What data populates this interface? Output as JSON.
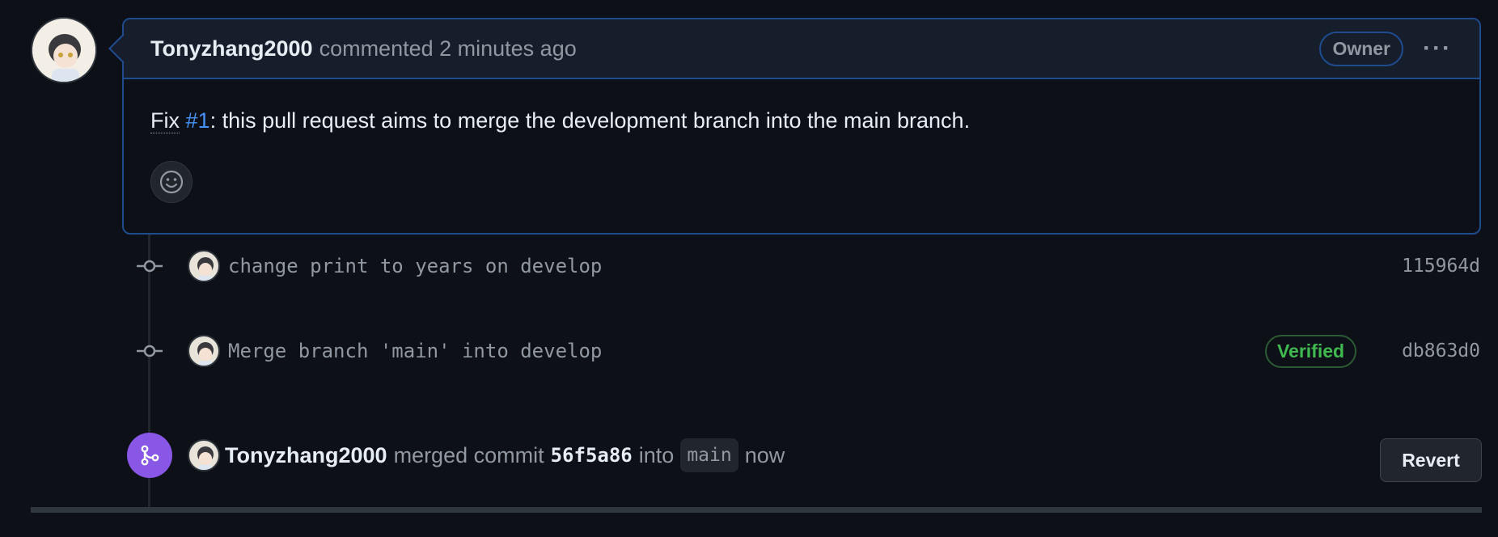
{
  "comment": {
    "author": "Tonyzhang2000",
    "meta": "commented 2 minutes ago",
    "badge": "Owner",
    "menu": "···",
    "body_fix": "Fix",
    "body_link": "#1",
    "body_rest": ": this pull request aims to merge the development branch into the main branch."
  },
  "commits": [
    {
      "message": "change print to years on develop",
      "sha": "115964d",
      "verified": ""
    },
    {
      "message": "Merge branch 'main' into develop",
      "sha": "db863d0",
      "verified": "Verified"
    }
  ],
  "merge": {
    "author": "Tonyzhang2000",
    "text_a": "merged commit",
    "sha": "56f5a86",
    "text_b": "into",
    "branch": "main",
    "text_c": "now",
    "revert_label": "Revert"
  },
  "colors": {
    "accent": "#4493f8",
    "merge": "#8957e5",
    "verified": "#3fb950",
    "border": "#1f4b8f"
  },
  "icons": [
    "avatar",
    "smiley-icon",
    "git-commit-icon",
    "git-merge-icon",
    "kebab-icon"
  ]
}
